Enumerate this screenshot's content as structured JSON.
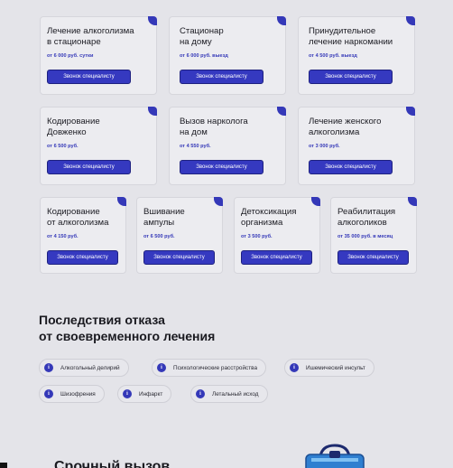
{
  "services": [
    {
      "title": [
        "Лечение алкоголизма",
        "в стационаре"
      ],
      "price": "от 6 000 руб. сутки",
      "button": "Звонок специалисту"
    },
    {
      "title": [
        "Стационар",
        "на дому"
      ],
      "price": "от 6 000 руб. выезд",
      "button": "Звонок специалисту"
    },
    {
      "title": [
        "Принудительное",
        "лечение наркомании"
      ],
      "price": "от 4 500 руб. выезд",
      "button": "Звонок специалисту"
    },
    {
      "title": [
        "Кодирование",
        "Довженко"
      ],
      "price": "от 6 500 руб.",
      "button": "Звонок специалисту"
    },
    {
      "title": [
        "Вызов нарколога",
        "на дом"
      ],
      "price": "от 4 550 руб.",
      "button": "Звонок специалисту"
    },
    {
      "title": [
        "Лечение женского",
        "алкоголизма"
      ],
      "price": "от 3 000 руб.",
      "button": "Звонок специалисту"
    },
    {
      "title": [
        "Кодирование",
        "от алкоголизма"
      ],
      "price": "от 4 150 руб.",
      "button": "Звонок специалисту"
    },
    {
      "title": [
        "Вшивание",
        "ампулы"
      ],
      "price": "от 6 500 руб.",
      "button": "Звонок специалисту"
    },
    {
      "title": [
        "Детоксикация",
        "организма"
      ],
      "price": "от 3 500 руб.",
      "button": "Звонок специалисту"
    },
    {
      "title": [
        "Реабилитация",
        "алкоголиков"
      ],
      "price": "от 35 000 руб. в месяц",
      "button": "Звонок специалисту"
    }
  ],
  "consequences": {
    "title": [
      "Последствия отказа",
      "от своевременного лечения"
    ],
    "icon": "info-icon",
    "icon_glyph": "i",
    "items": [
      "Алкогольный делирий",
      "Психологические расстройства",
      "Ишемический инсульт",
      "Шизофрения",
      "Инфаркт",
      "Летальный исход"
    ]
  },
  "footer": {
    "title": "Срочный вызов"
  },
  "colors": {
    "accent": "#3438b8",
    "background": "#e4e4e9"
  }
}
